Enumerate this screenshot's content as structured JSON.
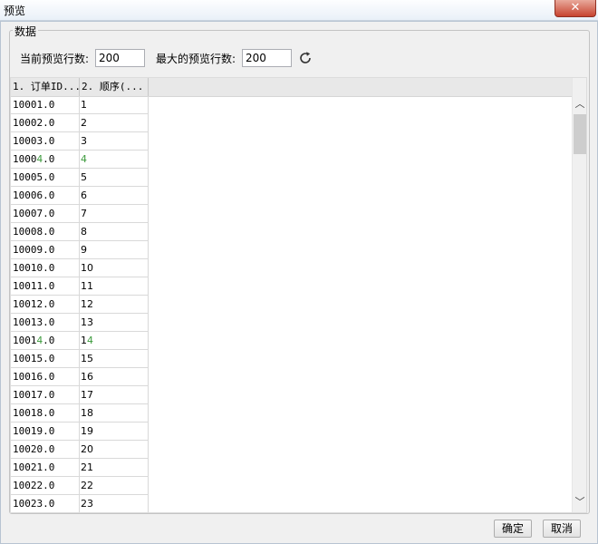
{
  "window": {
    "title": "预览",
    "close_symbol": "✕"
  },
  "group": {
    "legend": "数据"
  },
  "controls": {
    "current_rows_label": "当前预览行数:",
    "current_rows_value": "200",
    "max_rows_label": "最大的预览行数:",
    "max_rows_value": "200",
    "refresh_icon": "refresh-icon"
  },
  "table": {
    "columns": [
      "1. 订单ID...",
      "2. 顺序(..."
    ],
    "rows": [
      [
        "10001.0",
        "1"
      ],
      [
        "10002.0",
        "2"
      ],
      [
        "10003.0",
        "3"
      ],
      [
        "10004.0",
        "4"
      ],
      [
        "10005.0",
        "5"
      ],
      [
        "10006.0",
        "6"
      ],
      [
        "10007.0",
        "7"
      ],
      [
        "10008.0",
        "8"
      ],
      [
        "10009.0",
        "9"
      ],
      [
        "10010.0",
        "10"
      ],
      [
        "10011.0",
        "11"
      ],
      [
        "10012.0",
        "12"
      ],
      [
        "10013.0",
        "13"
      ],
      [
        "10014.0",
        "14"
      ],
      [
        "10015.0",
        "15"
      ],
      [
        "10016.0",
        "16"
      ],
      [
        "10017.0",
        "17"
      ],
      [
        "10018.0",
        "18"
      ],
      [
        "10019.0",
        "19"
      ],
      [
        "10020.0",
        "20"
      ],
      [
        "10021.0",
        "21"
      ],
      [
        "10022.0",
        "22"
      ],
      [
        "10023.0",
        "23"
      ]
    ]
  },
  "scrollbar": {
    "up_arrow": "︿",
    "down_arrow": "﹀"
  },
  "buttons": {
    "ok": "确定",
    "cancel": "取消"
  },
  "colors": {
    "highlight_digit": "#3c9a3c"
  }
}
